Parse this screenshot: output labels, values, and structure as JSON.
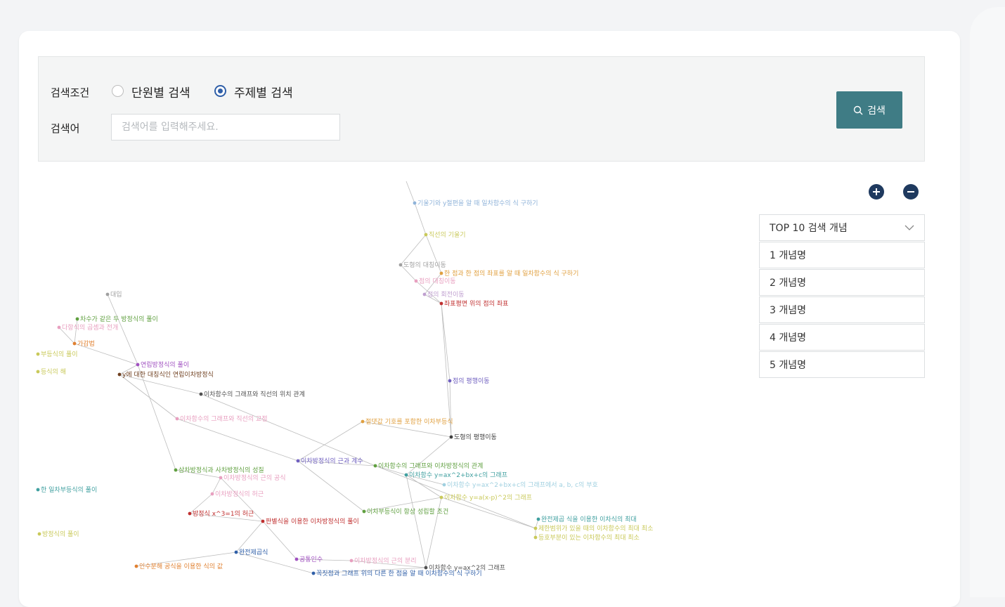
{
  "search": {
    "condition_label": "검색조건",
    "options": [
      "단원별 검색",
      "주제별 검색"
    ],
    "selected_option": "주제별 검색",
    "keyword_label": "검색어",
    "placeholder": "검색어를 입력해주세요.",
    "button_label": "검색"
  },
  "zoom": {
    "in_icon": "plus-circle-icon",
    "out_icon": "minus-circle-icon"
  },
  "top_panel": {
    "title": "TOP 10 검색 개념",
    "items": [
      "1 개념명",
      "2 개념명",
      "3 개념명",
      "4 개념명",
      "5 개념명"
    ]
  },
  "graph": {
    "nodes": [
      {
        "label": "기울기와 y절편을 알 때 일차함수의 식 구하기",
        "color": "#8fb3d9"
      },
      {
        "label": "직선의 기울기",
        "color": "#c9c95a"
      },
      {
        "label": "도형의 대칭이동",
        "color": "#a0a0a0"
      },
      {
        "label": "한 점과 한 점의 좌표를 알 때 일차함수의 식 구하기",
        "color": "#e0a040"
      },
      {
        "label": "점의 대칭이동",
        "color": "#e8a0c0"
      },
      {
        "label": "점의 회전이동",
        "color": "#c0a0d0"
      },
      {
        "label": "좌표평면 위의 점의 좌표",
        "color": "#c03030"
      },
      {
        "label": "대입",
        "color": "#a0a0a0"
      },
      {
        "label": "점의 평행이동",
        "color": "#7060c0"
      },
      {
        "label": "도형의 평행이동",
        "color": "#404040"
      },
      {
        "label": "가감법",
        "color": "#e08030"
      },
      {
        "label": "이차함수의 그래프와 직선의 위치 관계",
        "color": "#505050"
      },
      {
        "label": "이차함수의 그래프와 직선의 교점",
        "color": "#e8a0c0"
      },
      {
        "label": "y에 대한 대칭식인 연립이차방정식",
        "color": "#704020"
      },
      {
        "label": "연립방정식의 풀이",
        "color": "#a050c0"
      },
      {
        "label": "이차방정식의 근과 계수",
        "color": "#7060c0"
      },
      {
        "label": "이차함수의 그래프와 이차방정식의 관계",
        "color": "#60a040"
      },
      {
        "label": "이차함수 y=ax^2+bx+c의 그래프",
        "color": "#40a0a0"
      },
      {
        "label": "이차함수 y=ax^2+bx+c의 그래프에서 a, b, c의 부호",
        "color": "#a0d0e0"
      },
      {
        "label": "이차함수 y=a(x-p)^2의 그래프",
        "color": "#c9c95a"
      },
      {
        "label": "삼차방정식과 사차방정식의 성질",
        "color": "#60a040"
      },
      {
        "label": "이차방정식의 근의 공식",
        "color": "#e8a0c0"
      },
      {
        "label": "이차방정식의 허근",
        "color": "#e8a0c0"
      },
      {
        "label": "방정식 x^3=1의 허근",
        "color": "#c03030"
      },
      {
        "label": "판별식을 이용한 이차방정식의 풀이",
        "color": "#c03030"
      },
      {
        "label": "이차부등식이 항상 성립할 조건",
        "color": "#60a040"
      },
      {
        "label": "완전제곱식",
        "color": "#2f5fa8"
      },
      {
        "label": "인수분해 공식을 이용한 식의 값",
        "color": "#e08030"
      },
      {
        "label": "공통인수",
        "color": "#a050c0"
      },
      {
        "label": "이차방정식의 근의 분리",
        "color": "#e8a0c0"
      },
      {
        "label": "이차함수 y=ax^2의 그래프",
        "color": "#505050"
      },
      {
        "label": "꼭짓점과 그래프 위의 다른 한 점을 알 때 이차함수의 식 구하기",
        "color": "#2f5fa8"
      },
      {
        "label": "제한범위가 있을 때의 이차함수의 최대 최소",
        "color": "#c9c95a"
      },
      {
        "label": "등호부분이 있는 이차함수의 최대 최소",
        "color": "#c9c95a"
      },
      {
        "label": "완전제곱 식을 이용한 이차식의 최대",
        "color": "#40a0a0"
      },
      {
        "label": "한 일차부등식의 풀이",
        "color": "#40a0a0"
      },
      {
        "label": "방정식의 풀이",
        "color": "#c9c95a"
      },
      {
        "label": "부등식의 풀이",
        "color": "#c9c95a"
      },
      {
        "label": "다항식의 곱셈과 전개",
        "color": "#e8a0c0"
      },
      {
        "label": "등식의 해",
        "color": "#c9c95a"
      },
      {
        "label": "차수가 같은 두 방정식의 풀이",
        "color": "#60a040"
      },
      {
        "label": "절댓값 기호를 포함한 이차부등식",
        "color": "#e0a040"
      }
    ]
  }
}
